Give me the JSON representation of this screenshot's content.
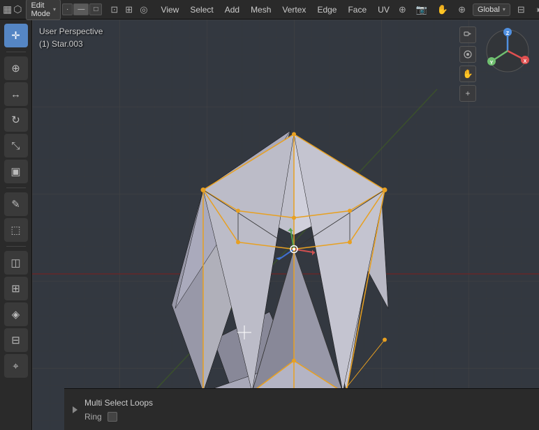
{
  "topbar": {
    "editor_icon": "▦",
    "mode_label": "Edit Mode",
    "mode_chevron": "▾",
    "mesh_modes": [
      {
        "label": "·",
        "title": "Vertex select",
        "active": false
      },
      {
        "label": "⬡",
        "title": "Edge select",
        "active": false
      },
      {
        "label": "◼",
        "title": "Face select",
        "active": false
      }
    ],
    "view_label": "View",
    "select_label": "Select",
    "add_label": "Add",
    "mesh_label": "Mesh",
    "vertex_label": "Vertex",
    "edge_label": "Edge",
    "face_label": "Face",
    "uv_label": "UV",
    "global_label": "Global",
    "global_chevron": "▾"
  },
  "viewport": {
    "perspective_label": "User Perspective",
    "object_label": "(1) Star.003"
  },
  "toolbar": {
    "tools": [
      {
        "icon": "✛",
        "name": "select-box-tool",
        "active": true
      },
      {
        "icon": "⊕",
        "name": "cursor-tool",
        "active": false
      },
      {
        "icon": "↔",
        "name": "move-tool",
        "active": false
      },
      {
        "icon": "↻",
        "name": "rotate-tool",
        "active": false
      },
      {
        "icon": "⤡",
        "name": "scale-tool",
        "active": false
      },
      {
        "icon": "▣",
        "name": "transform-tool",
        "active": false
      },
      {
        "icon": "✎",
        "name": "annotate-tool",
        "active": false
      },
      {
        "icon": "⬚",
        "name": "measure-tool",
        "active": false
      },
      {
        "icon": "◫",
        "name": "add-cube-tool",
        "active": false
      },
      {
        "icon": "⬡",
        "name": "loop-cut-tool",
        "active": false
      },
      {
        "icon": "⬤",
        "name": "extrude-tool",
        "active": false
      },
      {
        "icon": "⊞",
        "name": "inset-tool",
        "active": false
      },
      {
        "icon": "◈",
        "name": "bevel-tool",
        "active": false
      },
      {
        "icon": "⊟",
        "name": "knife-tool",
        "active": false
      },
      {
        "icon": "⌖",
        "name": "shrink-tool",
        "active": false
      }
    ]
  },
  "bottom_panel": {
    "title": "Multi Select Loops",
    "ring_label": "Ring",
    "ring_checked": false
  },
  "axes_gizmo": {
    "x_color": "#e05050",
    "y_color": "#70c070",
    "z_color": "#5090e0",
    "x_label": "X",
    "y_label": "Y",
    "z_label": "Z"
  },
  "colors": {
    "background": "#333",
    "grid_line": "#3d3d3d",
    "grid_line_major": "#444",
    "mesh_fill": "#c0c0c8",
    "mesh_edge": "#e8a020",
    "mesh_edge_selected": "#e8a020",
    "axis_x": "#c04040",
    "axis_y": "#80b830",
    "viewport_bg": "#333840"
  }
}
